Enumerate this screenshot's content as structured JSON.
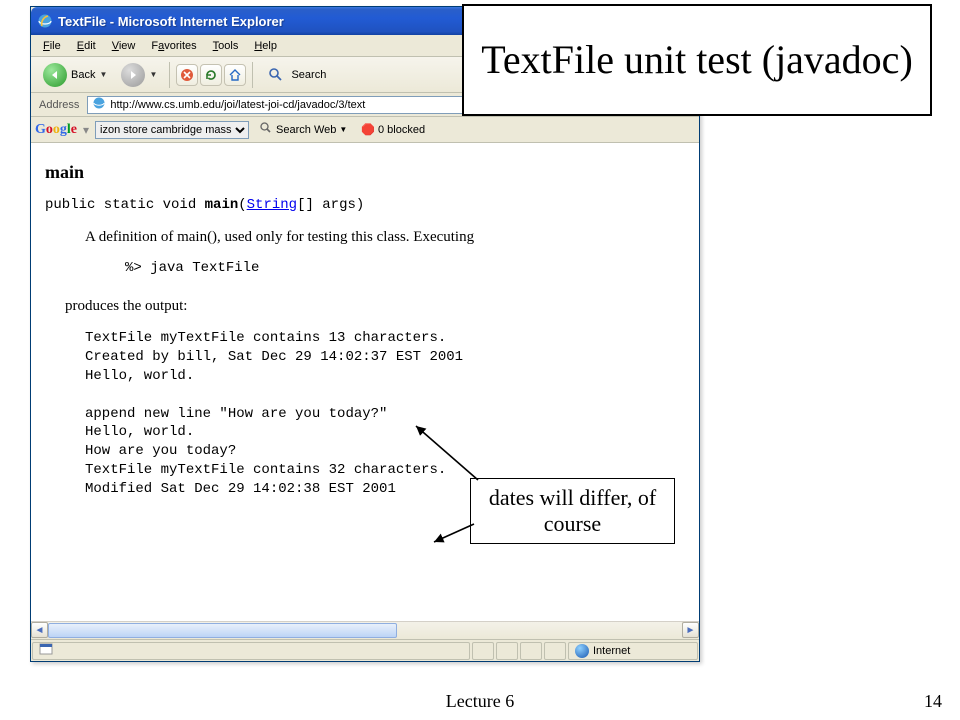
{
  "titlebar": {
    "title": "TextFile - Microsoft Internet Explorer"
  },
  "menu": {
    "file": "File",
    "edit": "Edit",
    "view": "View",
    "favorites": "Favorites",
    "tools": "Tools",
    "help": "Help"
  },
  "toolbar": {
    "back": "Back",
    "search": "Search"
  },
  "address": {
    "label": "Address",
    "url": "http://www.cs.umb.edu/joi/latest-joi-cd/javadoc/3/text"
  },
  "google": {
    "search_value": "izon store cambridge mass",
    "search_web": "Search Web",
    "blocked": "0 blocked"
  },
  "doc": {
    "heading": "main",
    "sig_prefix": "public static void ",
    "sig_method": "main",
    "sig_paren_open": "(",
    "sig_type": "String",
    "sig_rest": "[] args)",
    "desc": "A definition of main(), used only for testing this class. Executing",
    "cmd": "%> java TextFile",
    "produces": "produces the output:",
    "out1": "TextFile myTextFile contains 13 characters.",
    "out2": "Created by bill, Sat Dec 29 14:02:37 EST 2001",
    "out3": "Hello, world.",
    "out4": "append new line \"How are you today?\"",
    "out5": "Hello, world.",
    "out6": "How are you today?",
    "out7": "TextFile myTextFile contains 32 characters.",
    "out8": "Modified Sat Dec 29 14:02:38 EST 2001"
  },
  "status": {
    "zone": "Internet"
  },
  "annot": {
    "title": "TextFile unit test (javadoc)",
    "note": "dates will differ, of course"
  },
  "footer": {
    "lecture": "Lecture 6",
    "page": "14"
  }
}
